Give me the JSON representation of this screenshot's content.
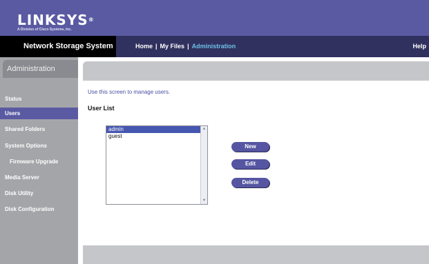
{
  "brand": {
    "name": "LINKSYS",
    "mark": "®",
    "tagline": "A Division of Cisco Systems, Inc."
  },
  "header": {
    "product": "Network Storage System",
    "nav": [
      {
        "label": "Home"
      },
      {
        "label": "My Files"
      },
      {
        "label": "Administration",
        "active": true
      }
    ],
    "separator": "|",
    "help": "Help"
  },
  "sidebar": {
    "title": "Administration",
    "items": [
      {
        "label": "Status"
      },
      {
        "label": "Users",
        "active": true
      },
      {
        "label": "Shared Folders"
      },
      {
        "label": "System Options"
      },
      {
        "label": "Firmware Upgrade",
        "indent": true
      },
      {
        "label": "Media Server"
      },
      {
        "label": "Disk Utility"
      },
      {
        "label": "Disk Configuration"
      }
    ]
  },
  "main": {
    "intro": "Use this screen to manage users.",
    "section_title": "User List",
    "users": [
      {
        "name": "admin",
        "selected": true
      },
      {
        "name": "guest",
        "selected": false
      }
    ],
    "buttons": {
      "new": "New",
      "edit": "Edit",
      "delete": "Delete"
    }
  },
  "colors": {
    "brand_band": "#5a5aa3",
    "nav_band": "#31315f",
    "active_nav": "#6cc0e8",
    "sidebar": "#a4a5a9",
    "selection": "#4657b0"
  }
}
